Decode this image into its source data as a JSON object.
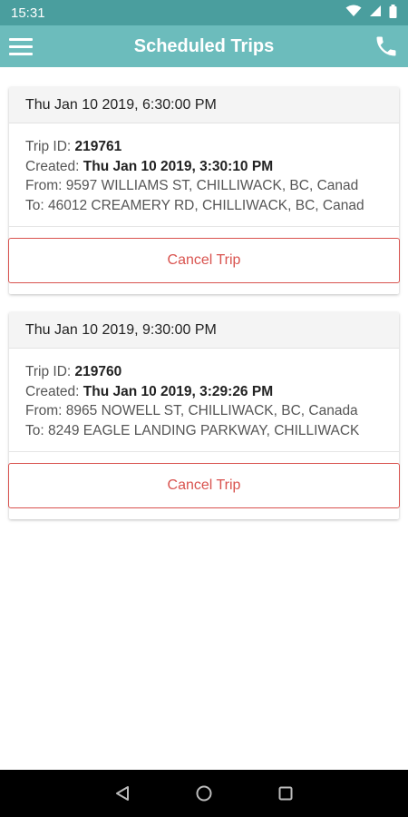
{
  "status_bar": {
    "time": "15:31"
  },
  "app_bar": {
    "title": "Scheduled Trips"
  },
  "trips": [
    {
      "scheduled": "Thu Jan 10 2019, 6:30:00 PM",
      "trip_id_label": "Trip ID: ",
      "trip_id": "219761",
      "created_label": "Created: ",
      "created": "Thu Jan 10 2019, 3:30:10 PM",
      "from_label": "From: ",
      "from": "9597 WILLIAMS ST, CHILLIWACK, BC, Canad",
      "to_label": "To: ",
      "to": "46012 CREAMERY RD, CHILLIWACK, BC, Canad",
      "cancel_label": "Cancel Trip"
    },
    {
      "scheduled": "Thu Jan 10 2019, 9:30:00 PM",
      "trip_id_label": "Trip ID: ",
      "trip_id": "219760",
      "created_label": "Created: ",
      "created": "Thu Jan 10 2019, 3:29:26 PM",
      "from_label": "From: ",
      "from": "8965 NOWELL ST, CHILLIWACK, BC, Canada",
      "to_label": "To: ",
      "to": "8249 EAGLE LANDING PARKWAY, CHILLIWACK",
      "cancel_label": "Cancel Trip"
    }
  ],
  "colors": {
    "app_bar": "#6cbcbc",
    "status_bar": "#4a9e9e",
    "cancel": "#d9534f"
  },
  "icons": [
    "wifi-icon",
    "signal-icon",
    "battery-icon",
    "menu-icon",
    "phone-icon",
    "back-icon",
    "home-icon",
    "recents-icon"
  ]
}
